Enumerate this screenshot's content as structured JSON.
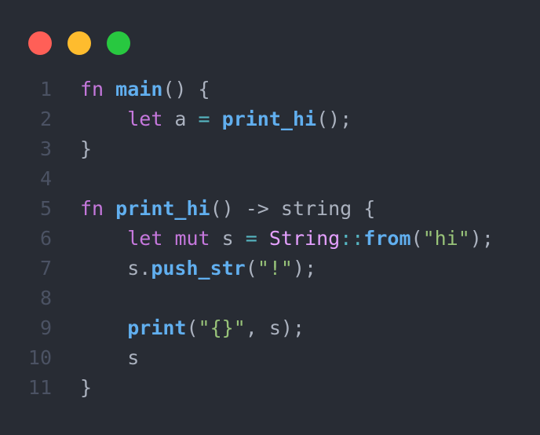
{
  "window": {
    "buttons": [
      {
        "name": "close",
        "color": "#ff5f57"
      },
      {
        "name": "minimize",
        "color": "#febc2e"
      },
      {
        "name": "maximize",
        "color": "#28c840"
      }
    ]
  },
  "code": {
    "lines": [
      {
        "num": "1",
        "indent": "",
        "tokens": [
          {
            "t": "kw",
            "v": "fn"
          },
          {
            "t": "pl",
            "v": " "
          },
          {
            "t": "fn",
            "v": "main"
          },
          {
            "t": "pl",
            "v": "() {"
          }
        ]
      },
      {
        "num": "2",
        "indent": "    ",
        "tokens": [
          {
            "t": "kw",
            "v": "let"
          },
          {
            "t": "pl",
            "v": " a "
          },
          {
            "t": "op",
            "v": "="
          },
          {
            "t": "pl",
            "v": " "
          },
          {
            "t": "fn",
            "v": "print_hi"
          },
          {
            "t": "pl",
            "v": "();"
          }
        ]
      },
      {
        "num": "3",
        "indent": "",
        "tokens": [
          {
            "t": "pl",
            "v": "}"
          }
        ]
      },
      {
        "num": "4",
        "indent": "",
        "tokens": []
      },
      {
        "num": "5",
        "indent": "",
        "tokens": [
          {
            "t": "kw",
            "v": "fn"
          },
          {
            "t": "pl",
            "v": " "
          },
          {
            "t": "fn",
            "v": "print_hi"
          },
          {
            "t": "pl",
            "v": "() -> string {"
          }
        ]
      },
      {
        "num": "6",
        "indent": "    ",
        "tokens": [
          {
            "t": "kw",
            "v": "let"
          },
          {
            "t": "pl",
            "v": " "
          },
          {
            "t": "kw",
            "v": "mut"
          },
          {
            "t": "pl",
            "v": " s "
          },
          {
            "t": "op",
            "v": "="
          },
          {
            "t": "pl",
            "v": " "
          },
          {
            "t": "type",
            "v": "String"
          },
          {
            "t": "op",
            "v": "::"
          },
          {
            "t": "fn",
            "v": "from"
          },
          {
            "t": "pl",
            "v": "("
          },
          {
            "t": "str",
            "v": "\"hi\""
          },
          {
            "t": "pl",
            "v": ");"
          }
        ]
      },
      {
        "num": "7",
        "indent": "    ",
        "tokens": [
          {
            "t": "pl",
            "v": "s."
          },
          {
            "t": "fn",
            "v": "push_str"
          },
          {
            "t": "pl",
            "v": "("
          },
          {
            "t": "str",
            "v": "\"!\""
          },
          {
            "t": "pl",
            "v": ");"
          }
        ]
      },
      {
        "num": "8",
        "indent": "",
        "tokens": []
      },
      {
        "num": "9",
        "indent": "    ",
        "tokens": [
          {
            "t": "fn",
            "v": "print"
          },
          {
            "t": "pl",
            "v": "("
          },
          {
            "t": "str",
            "v": "\"{}\""
          },
          {
            "t": "pl",
            "v": ", s);"
          }
        ]
      },
      {
        "num": "10",
        "indent": "    ",
        "tokens": [
          {
            "t": "pl",
            "v": "s"
          }
        ]
      },
      {
        "num": "11",
        "indent": "",
        "tokens": [
          {
            "t": "pl",
            "v": "}"
          }
        ]
      }
    ]
  }
}
